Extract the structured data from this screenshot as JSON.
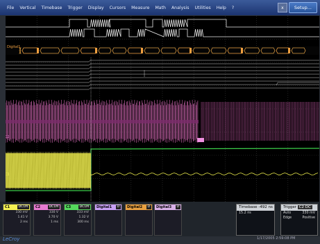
{
  "menu": {
    "items": [
      "File",
      "Vertical",
      "Timebase",
      "Trigger",
      "Display",
      "Cursors",
      "Measure",
      "Math",
      "Analysis",
      "Utilities",
      "Help"
    ],
    "help_marker": "?",
    "close_label": "x",
    "setup_label": "Setup..."
  },
  "scope": {
    "bus_labels": [
      "Digital1"
    ],
    "channel_markers": {
      "c2": "C2",
      "c1": "C1"
    },
    "digital_marker": "Dg"
  },
  "descriptors": [
    {
      "name": "C1",
      "tag": "DC1M",
      "color": "#f4f052",
      "rows": [
        "330 mV",
        "1.41 V",
        "2 ms"
      ]
    },
    {
      "name": "C2",
      "tag": "DC1M",
      "color": "#e57ad0",
      "rows": [
        "330 V",
        "3.70 V",
        "1 ms"
      ]
    },
    {
      "name": "C3",
      "tag": "DC1M",
      "color": "#54d85c",
      "rows": [
        "333 mV",
        "1.32 V",
        "300 ms"
      ]
    },
    {
      "name": "Digital1",
      "tag": "D",
      "color": "#c8a0f5",
      "rows": [
        "",
        "",
        ""
      ]
    },
    {
      "name": "Digital2",
      "tag": "D",
      "color": "#e8a040",
      "rows": [
        "",
        ""
      ]
    },
    {
      "name": "Digital3",
      "tag": "D",
      "color": "#d8b0e8",
      "rows": [
        "",
        ""
      ]
    }
  ],
  "timebase": {
    "label": "Timebase",
    "value": "-492 ns",
    "rows": [
      [
        "",
        ""
      ],
      [
        "",
        ""
      ]
    ],
    "extra": "15.2 ns"
  },
  "trigger": {
    "label": "Trigger",
    "tag": "C2 DC",
    "rows": [
      [
        "Auto",
        "330 mV"
      ],
      [
        "Edge",
        "Positive"
      ]
    ]
  },
  "footer": {
    "brand": "LeCroy",
    "date": "1/17/2005 2:59:08 PM"
  }
}
